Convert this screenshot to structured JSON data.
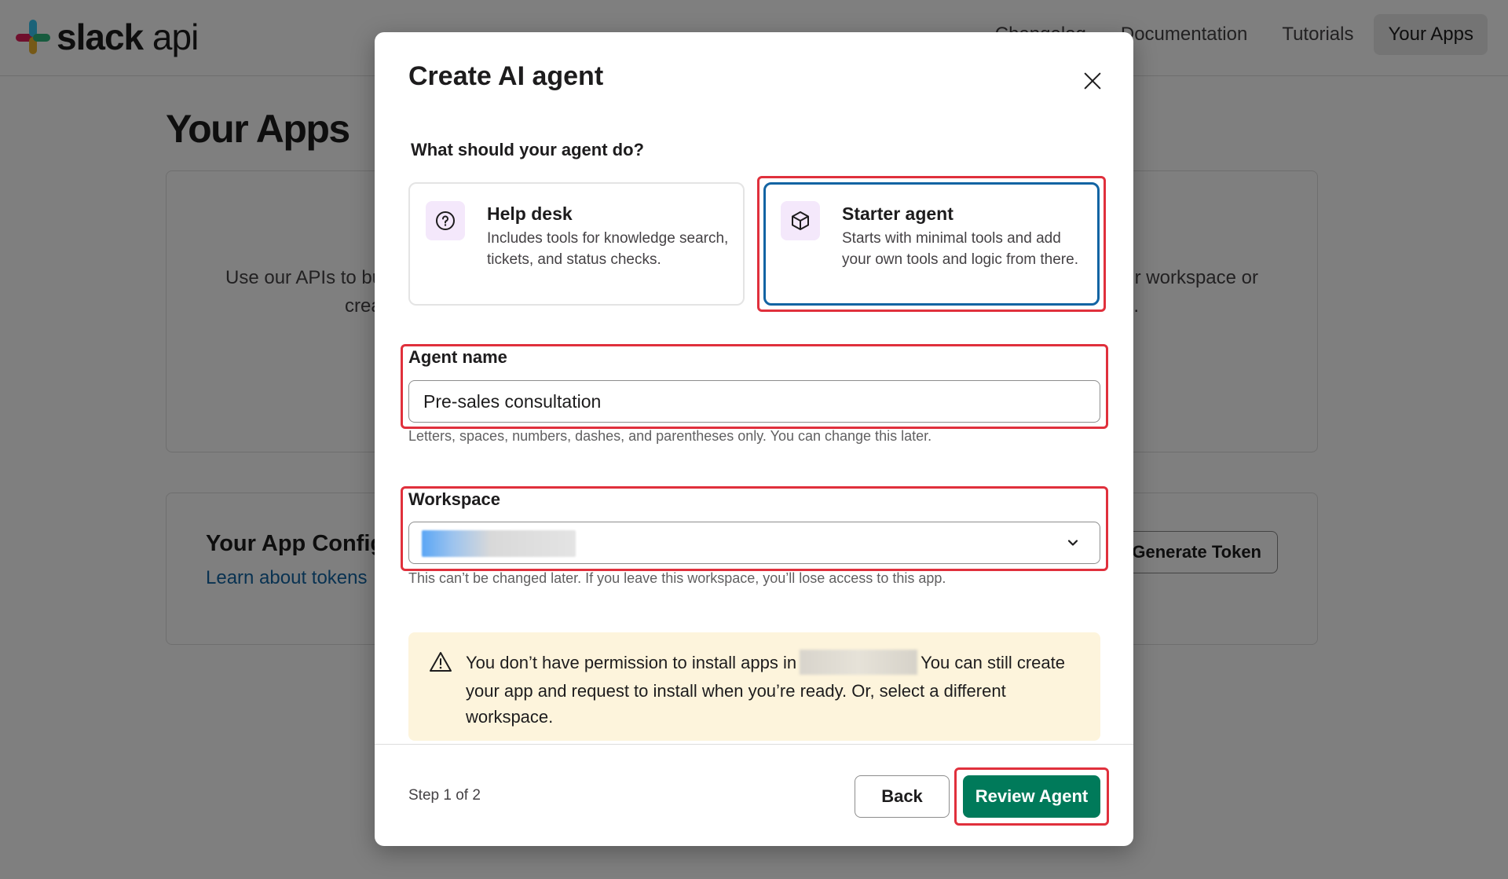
{
  "header": {
    "logo_text": "slack",
    "logo_suffix": "api",
    "nav": [
      {
        "label": "Changelog"
      },
      {
        "label": "Documentation"
      },
      {
        "label": "Tutorials"
      },
      {
        "label": "Your Apps"
      }
    ]
  },
  "page": {
    "title": "Your Apps",
    "intro_left_1": "Use our APIs to bu",
    "intro_left_2": "crea",
    "intro_right_1": "ur workspace or",
    "intro_right_2": ".",
    "config_title": "Your App Config",
    "config_link": "Learn about tokens",
    "generate_token": "Generate Token"
  },
  "modal": {
    "title": "Create AI agent",
    "question": "What should your agent do?",
    "options": [
      {
        "title": "Help desk",
        "description": "Includes tools for knowledge search, tickets, and status checks.",
        "icon": "question-circle-icon",
        "selected": false
      },
      {
        "title": "Starter agent",
        "description": "Starts with minimal tools and add your own tools and logic from there.",
        "icon": "cube-icon",
        "selected": true
      }
    ],
    "agent_name": {
      "label": "Agent name",
      "value": "Pre-sales consultation",
      "hint": "Letters, spaces, numbers, dashes, and parentheses only. You can change this later."
    },
    "workspace": {
      "label": "Workspace",
      "hint": "This can’t be changed later. If you leave this workspace, you’ll lose access to this app."
    },
    "warning": {
      "text_before": "You don’t have permission to install apps in",
      "text_after": "You can still create your app and request to install when you’re ready. Or, select a different workspace."
    },
    "footer": {
      "step": "Step 1 of 2",
      "back": "Back",
      "review": "Review Agent"
    }
  },
  "colors": {
    "primary_button": "#007a5a",
    "selected_border": "#1264a3",
    "highlight": "#e0303c",
    "warning_bg": "#fdf4dc"
  }
}
